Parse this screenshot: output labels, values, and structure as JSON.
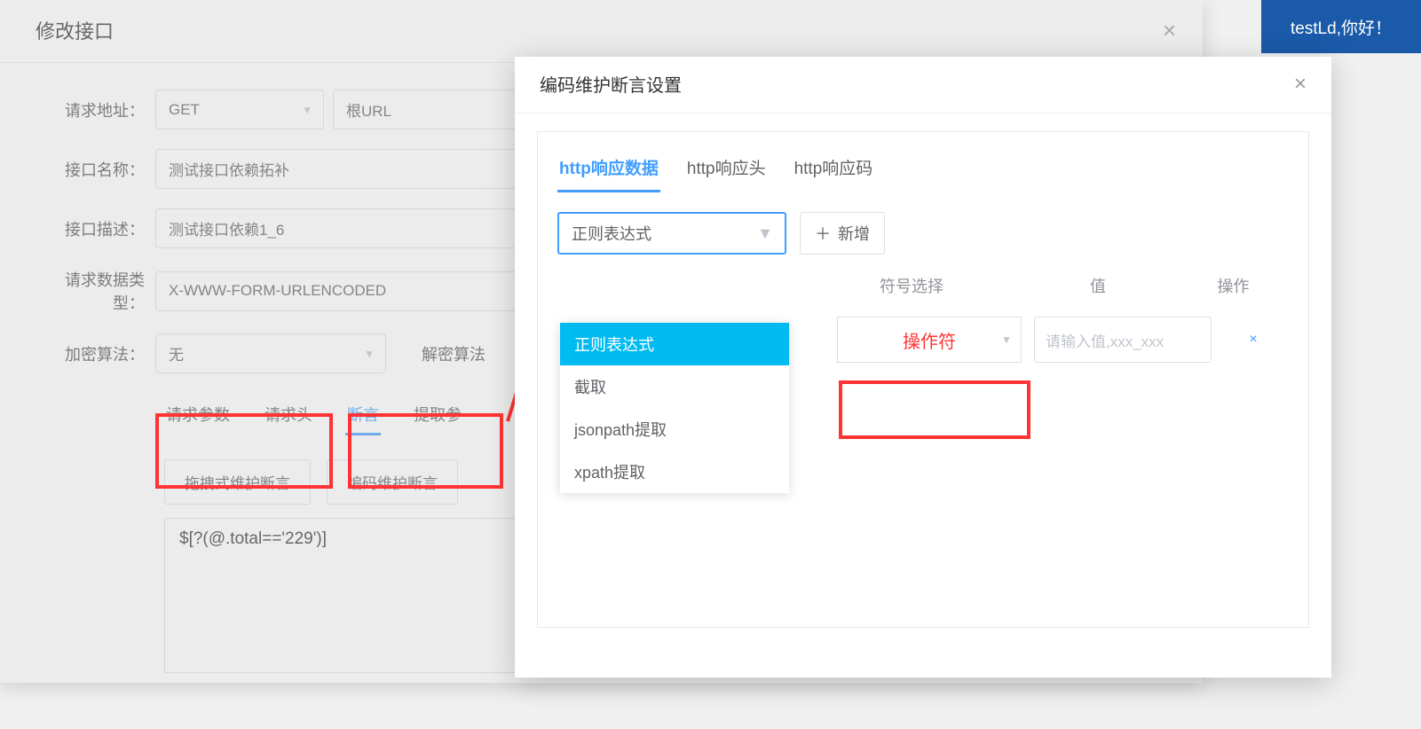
{
  "user_greeting": "testLd,你好！",
  "background_dialog": {
    "title": "修改接口",
    "close": "×",
    "labels": {
      "request_url": "请求地址：",
      "api_name": "接口名称：",
      "api_desc": "接口描述：",
      "data_type": "请求数据类型：",
      "encrypt": "加密算法：",
      "decrypt": "解密算法"
    },
    "values": {
      "method": "GET",
      "url": "根URL",
      "api_name": "测试接口依赖拓补",
      "api_desc": "测试接口依赖1_6",
      "data_type": "X-WWW-FORM-URLENCODED",
      "encrypt": "无"
    },
    "inner_tabs": {
      "params": "请求参数",
      "headers": "请求头",
      "assert": "断言",
      "extract": "提取参"
    },
    "buttons": {
      "drag_assert": "拖拽式维护断言",
      "code_assert": "编码维护断言"
    },
    "expression": "$[?(@.total=='229')]"
  },
  "foreground_dialog": {
    "title": "编码维护断言设置",
    "close": "×",
    "tabs": {
      "resp_data": "http响应数据",
      "resp_headers": "http响应头",
      "resp_code": "http响应码"
    },
    "select_value": "正则表达式",
    "add_button": "新增",
    "dropdown_items": {
      "regex": "正则表达式",
      "substr": "截取",
      "jsonpath": "jsonpath提取",
      "xpath": "xpath提取"
    },
    "table_headers": {
      "symbol": "符号选择",
      "value": "值",
      "action": "操作"
    },
    "row": {
      "operator": "操作符",
      "value_placeholder": "请输入值,xxx_xxx",
      "delete": "×"
    }
  }
}
